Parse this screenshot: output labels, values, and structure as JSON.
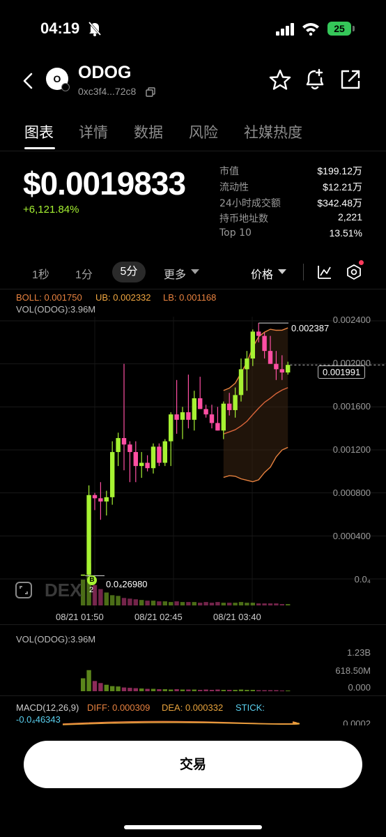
{
  "status_bar": {
    "time": "04:19",
    "battery": "25"
  },
  "header": {
    "title": "ODOG",
    "address": "0xc3f4...72c8",
    "avatar_text": "O"
  },
  "tabs": [
    {
      "label": "图表",
      "active": true
    },
    {
      "label": "详情",
      "active": false
    },
    {
      "label": "数据",
      "active": false
    },
    {
      "label": "风险",
      "active": false
    },
    {
      "label": "社媒热度",
      "active": false
    }
  ],
  "price": {
    "value": "$0.0019833",
    "change": "+6,121.84%"
  },
  "stats": [
    {
      "label": "市值",
      "value": "$199.12万"
    },
    {
      "label": "流动性",
      "value": "$12.21万"
    },
    {
      "label": "24小时成交额",
      "value": "$342.48万"
    },
    {
      "label": "持币地址数",
      "value": "2,221"
    },
    {
      "label": "Top 10",
      "value": "13.51%"
    }
  ],
  "toolbar": {
    "timeframes": [
      "1秒",
      "1分",
      "5分"
    ],
    "selected_timeframe": "5分",
    "more_label": "更多",
    "price_label": "价格"
  },
  "chart": {
    "boll_label": "BOLL: 0.001750",
    "ub_label": "UB: 0.002332",
    "lb_label": "LB: 0.001168",
    "vol_overlay_label": "VOL(ODOG):3.96M",
    "y_ticks": [
      "0.002400",
      "0.002000",
      "0.001600",
      "0.001200",
      "0.000800",
      "0.000400",
      "0.0₄"
    ],
    "high_label": "0.002387",
    "low_label": "0.0₄26980",
    "current_price_label": "0.001991",
    "buy_marker": "B",
    "buy_count": "2",
    "x_ticks": [
      "08/21 01:50",
      "08/21 02:45",
      "08/21 03:40"
    ],
    "watermark": "DEX"
  },
  "volume_panel": {
    "label": "VOL(ODOG):3.96M",
    "y_ticks": [
      "1.23B",
      "618.50M",
      "0.000"
    ]
  },
  "macd": {
    "label": "MACD(12,26,9)",
    "diff": "DIFF: 0.000309",
    "dea": "DEA: 0.000332",
    "stick_label": "STICK:",
    "stick_value": "-0.0₄46343",
    "y_tick": "0.0002"
  },
  "trade_button": "交易",
  "colors": {
    "up": "#a6f232",
    "down": "#ff4fa3",
    "boll_upper": "#e8823f",
    "macd_dea": "#e8a33c",
    "stick": "#5ad0ef"
  },
  "chart_data": {
    "type": "candlestick",
    "y_range": [
      0,
      0.0024
    ],
    "candles": [
      {
        "o": 4e-05,
        "h": 4e-05,
        "l": 3e-05,
        "c": 4e-05
      },
      {
        "o": 4e-05,
        "h": 0.00087,
        "l": 3e-05,
        "c": 0.00078
      },
      {
        "o": 0.00078,
        "h": 0.0008,
        "l": 0.00064,
        "c": 0.00075
      },
      {
        "o": 0.00075,
        "h": 0.0009,
        "l": 0.00055,
        "c": 0.00072
      },
      {
        "o": 0.00072,
        "h": 0.00082,
        "l": 0.00059,
        "c": 0.00076
      },
      {
        "o": 0.00076,
        "h": 0.00128,
        "l": 0.00069,
        "c": 0.00118
      },
      {
        "o": 0.00118,
        "h": 0.00136,
        "l": 0.00105,
        "c": 0.00131
      },
      {
        "o": 0.00131,
        "h": 0.002,
        "l": 0.00101,
        "c": 0.00125
      },
      {
        "o": 0.00125,
        "h": 0.00128,
        "l": 0.0009,
        "c": 0.00118
      },
      {
        "o": 0.00118,
        "h": 0.00128,
        "l": 0.0009,
        "c": 0.00105
      },
      {
        "o": 0.00105,
        "h": 0.00118,
        "l": 0.00094,
        "c": 0.00108
      },
      {
        "o": 0.00108,
        "h": 0.00115,
        "l": 0.001,
        "c": 0.00103
      },
      {
        "o": 0.00103,
        "h": 0.00126,
        "l": 0.00098,
        "c": 0.00123
      },
      {
        "o": 0.00123,
        "h": 0.00126,
        "l": 0.00105,
        "c": 0.00108
      },
      {
        "o": 0.00108,
        "h": 0.0013,
        "l": 0.00105,
        "c": 0.00128
      },
      {
        "o": 0.00128,
        "h": 0.00155,
        "l": 0.00105,
        "c": 0.00153
      },
      {
        "o": 0.00153,
        "h": 0.00185,
        "l": 0.00135,
        "c": 0.00148
      },
      {
        "o": 0.00148,
        "h": 0.0016,
        "l": 0.0013,
        "c": 0.00155
      },
      {
        "o": 0.00155,
        "h": 0.0019,
        "l": 0.0014,
        "c": 0.00148
      },
      {
        "o": 0.00148,
        "h": 0.00175,
        "l": 0.00138,
        "c": 0.00168
      },
      {
        "o": 0.00168,
        "h": 0.00188,
        "l": 0.00158,
        "c": 0.00158
      },
      {
        "o": 0.00158,
        "h": 0.00162,
        "l": 0.0015,
        "c": 0.00153
      },
      {
        "o": 0.00153,
        "h": 0.00162,
        "l": 0.0014,
        "c": 0.00145
      },
      {
        "o": 0.00145,
        "h": 0.0016,
        "l": 0.00138,
        "c": 0.00138
      },
      {
        "o": 0.00138,
        "h": 0.00165,
        "l": 0.0013,
        "c": 0.00163
      },
      {
        "o": 0.00163,
        "h": 0.00173,
        "l": 0.00152,
        "c": 0.00157
      },
      {
        "o": 0.00157,
        "h": 0.00178,
        "l": 0.0015,
        "c": 0.00171
      },
      {
        "o": 0.00171,
        "h": 0.00205,
        "l": 0.00165,
        "c": 0.00195
      },
      {
        "o": 0.00195,
        "h": 0.00212,
        "l": 0.00175,
        "c": 0.00205
      },
      {
        "o": 0.00205,
        "h": 0.00232,
        "l": 0.00198,
        "c": 0.0023
      },
      {
        "o": 0.0023,
        "h": 0.00238,
        "l": 0.0022,
        "c": 0.00226
      },
      {
        "o": 0.00226,
        "h": 0.00229,
        "l": 0.00205,
        "c": 0.00212
      },
      {
        "o": 0.00212,
        "h": 0.00226,
        "l": 0.002,
        "c": 0.002
      },
      {
        "o": 0.002,
        "h": 0.00212,
        "l": 0.00185,
        "c": 0.00195
      },
      {
        "o": 0.00195,
        "h": 0.00208,
        "l": 0.00185,
        "c": 0.00192
      },
      {
        "o": 0.00192,
        "h": 0.00202,
        "l": 0.0019,
        "c": 0.00199
      }
    ],
    "volume": [
      0.38,
      0.62,
      0.3,
      0.24,
      0.19,
      0.15,
      0.14,
      0.11,
      0.1,
      0.09,
      0.08,
      0.07,
      0.07,
      0.06,
      0.06,
      0.05,
      0.06,
      0.05,
      0.05,
      0.05,
      0.04,
      0.05,
      0.04,
      0.05,
      0.04,
      0.04,
      0.04,
      0.05,
      0.04,
      0.04,
      0.03,
      0.03,
      0.03,
      0.03,
      0.02,
      0.02
    ],
    "volume_ylim": [
      0,
      1.23
    ]
  }
}
